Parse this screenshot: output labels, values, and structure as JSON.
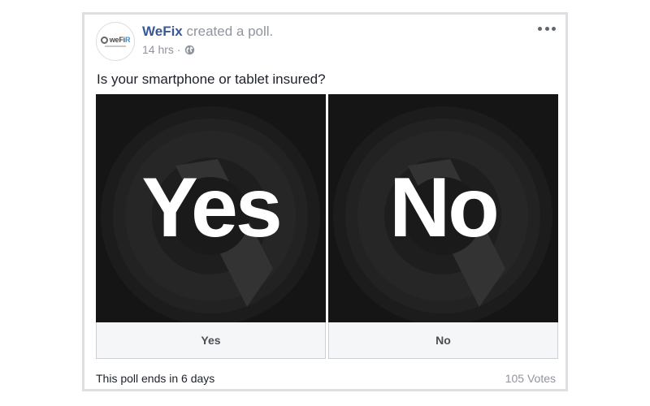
{
  "post": {
    "avatar_text_a": "weFi",
    "avatar_text_b": "R",
    "author": "WeFix",
    "action": " created a poll.",
    "time": "14 hrs",
    "separator": "·",
    "privacy_icon": "globe-icon",
    "more_icon": "more-dots-icon"
  },
  "poll": {
    "question": "Is your smartphone or tablet insured?",
    "options": [
      {
        "image_text": "Yes",
        "label": "Yes"
      },
      {
        "image_text": "No",
        "label": "No"
      }
    ],
    "ends_text": "This poll ends in 6 days",
    "votes_text": "105 Votes"
  },
  "colors": {
    "author": "#385898",
    "muted": "#90949c",
    "tile_bg": "#151515",
    "button_bg": "#f5f6f7"
  }
}
